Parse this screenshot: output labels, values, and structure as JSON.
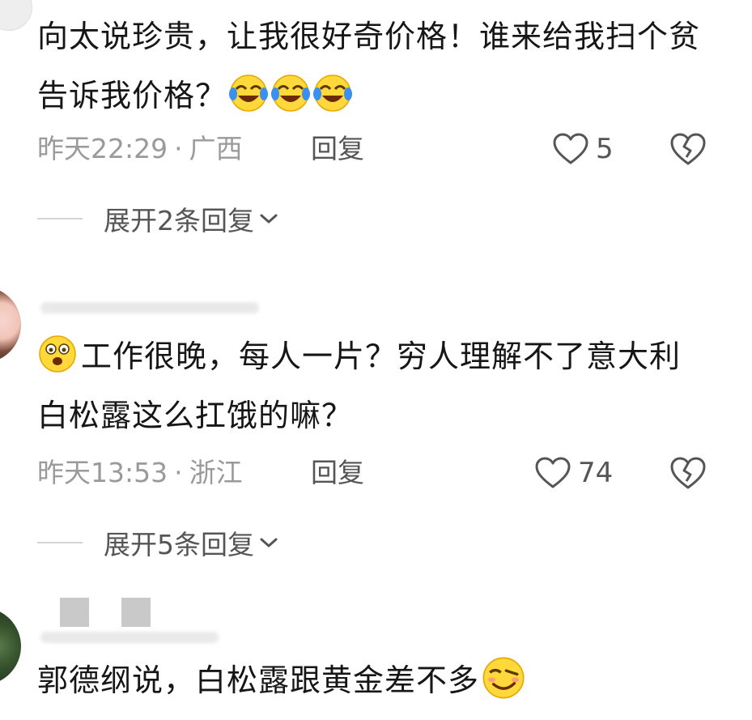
{
  "comments": [
    {
      "text": "向太说珍贵，让我很好奇价格！谁来给我扫个贫告诉我价格？",
      "emojis": [
        "laugh-cry-emoji",
        "laugh-cry-emoji",
        "laugh-cry-emoji"
      ],
      "time": "昨天22:29",
      "separator": "·",
      "location": "广西",
      "reply_label": "回复",
      "likes": "5",
      "expand_label": "展开2条回复"
    },
    {
      "lead_emoji": "shocked-face-emoji",
      "text": "工作很晚，每人一片？穷人理解不了意大利白松露这么扛饿的嘛？",
      "time": "昨天13:53",
      "separator": "·",
      "location": "浙江",
      "reply_label": "回复",
      "likes": "74",
      "expand_label": "展开5条回复"
    },
    {
      "text": "郭德纲说，白松露跟黄金差不多",
      "emojis": [
        "smirk-face-emoji"
      ]
    }
  ],
  "colors": {
    "text": "#161616",
    "meta": "#9a9a9a",
    "action": "#555555",
    "emoji_yellow": "#ffd93b",
    "tear_blue": "#3a8ff0"
  }
}
